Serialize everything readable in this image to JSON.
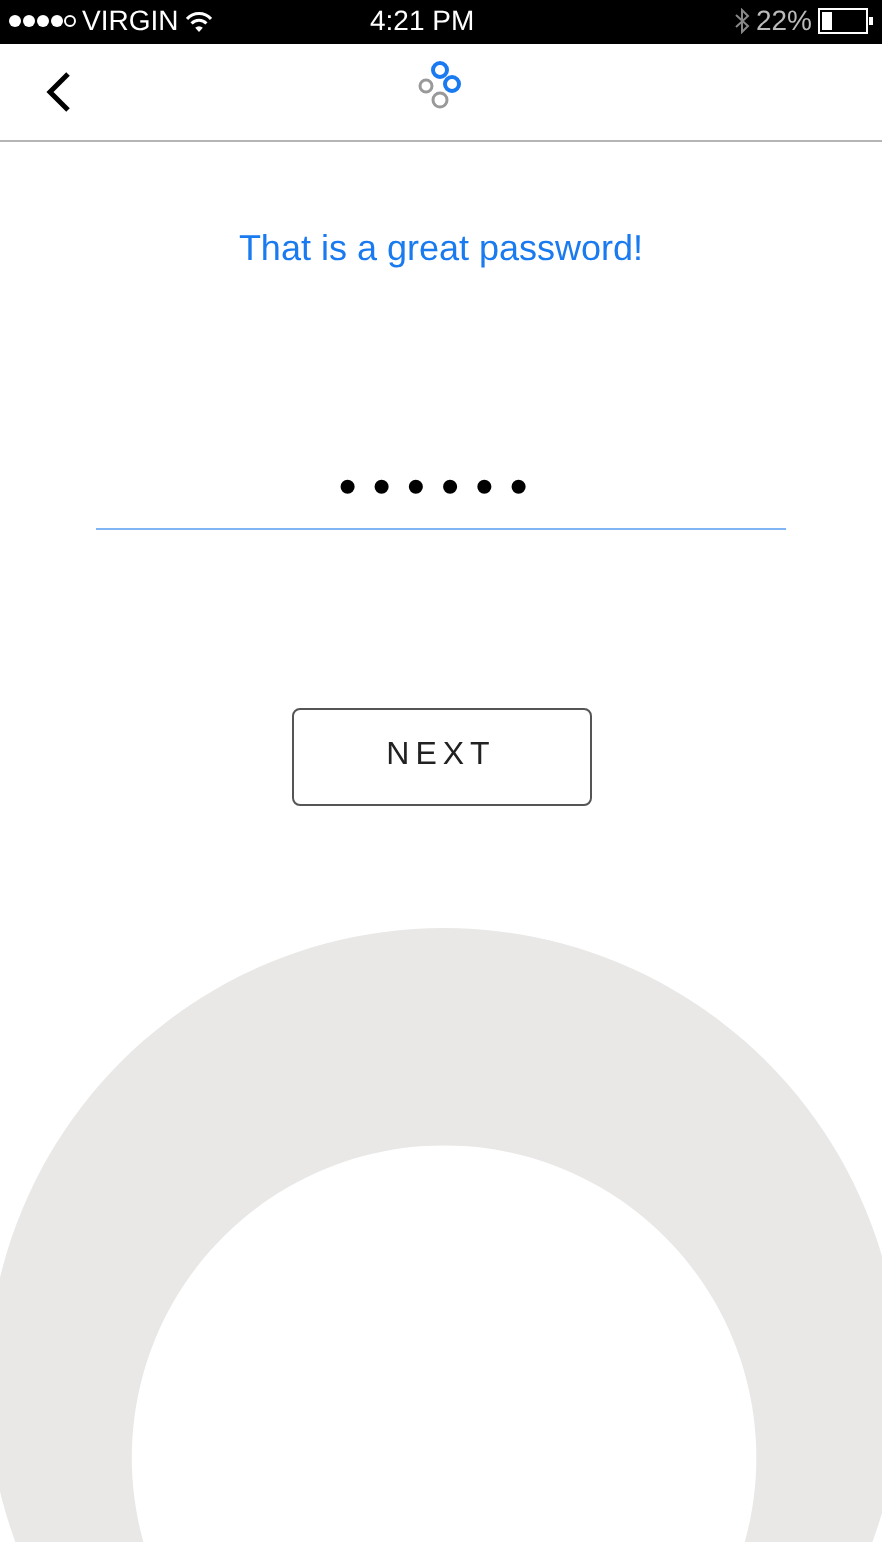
{
  "status_bar": {
    "carrier": "VIRGIN",
    "time": "4:21 PM",
    "battery_percent": "22%"
  },
  "message": "That is a great password!",
  "password_field": {
    "value": "••••••"
  },
  "buttons": [
    {
      "label": "NEXT"
    }
  ]
}
